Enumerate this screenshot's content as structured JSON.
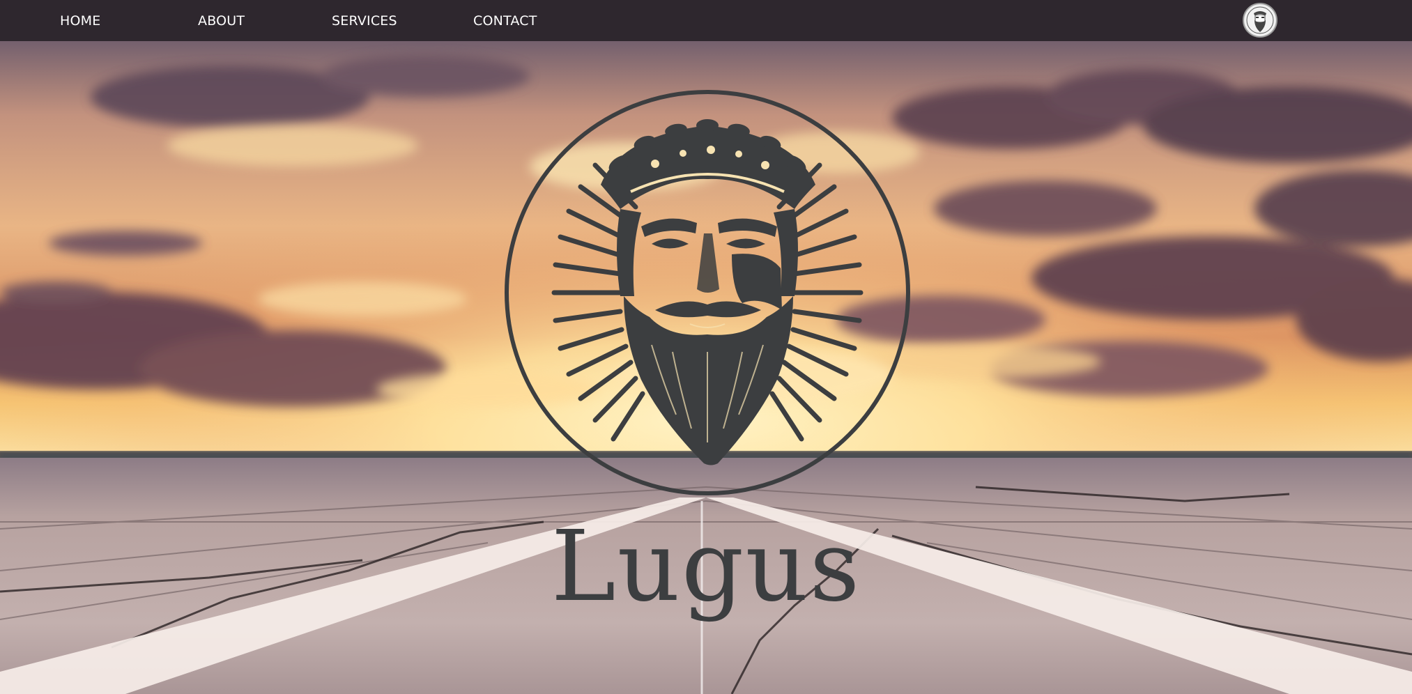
{
  "nav": {
    "home_label": "HOME",
    "about_label": "ABOUT",
    "services_label": "SERVICES",
    "contact_label": "CONTACT",
    "avatar_icon": "bearded-head-icon"
  },
  "hero": {
    "background": "sunset-sky-over-runway",
    "logo_icon": "bearded-man-laurel-crown-emblem-icon",
    "brand_name": "Lugus"
  },
  "colors": {
    "navbar": "#2e272e",
    "nav_text": "#ffffff",
    "logo_ink": "#3c3e40",
    "sky_top": "#6e5a6a",
    "sky_glow": "#fbe2a4",
    "runway": "#b6a4a4",
    "runway_stripes": "#f6ede9"
  }
}
